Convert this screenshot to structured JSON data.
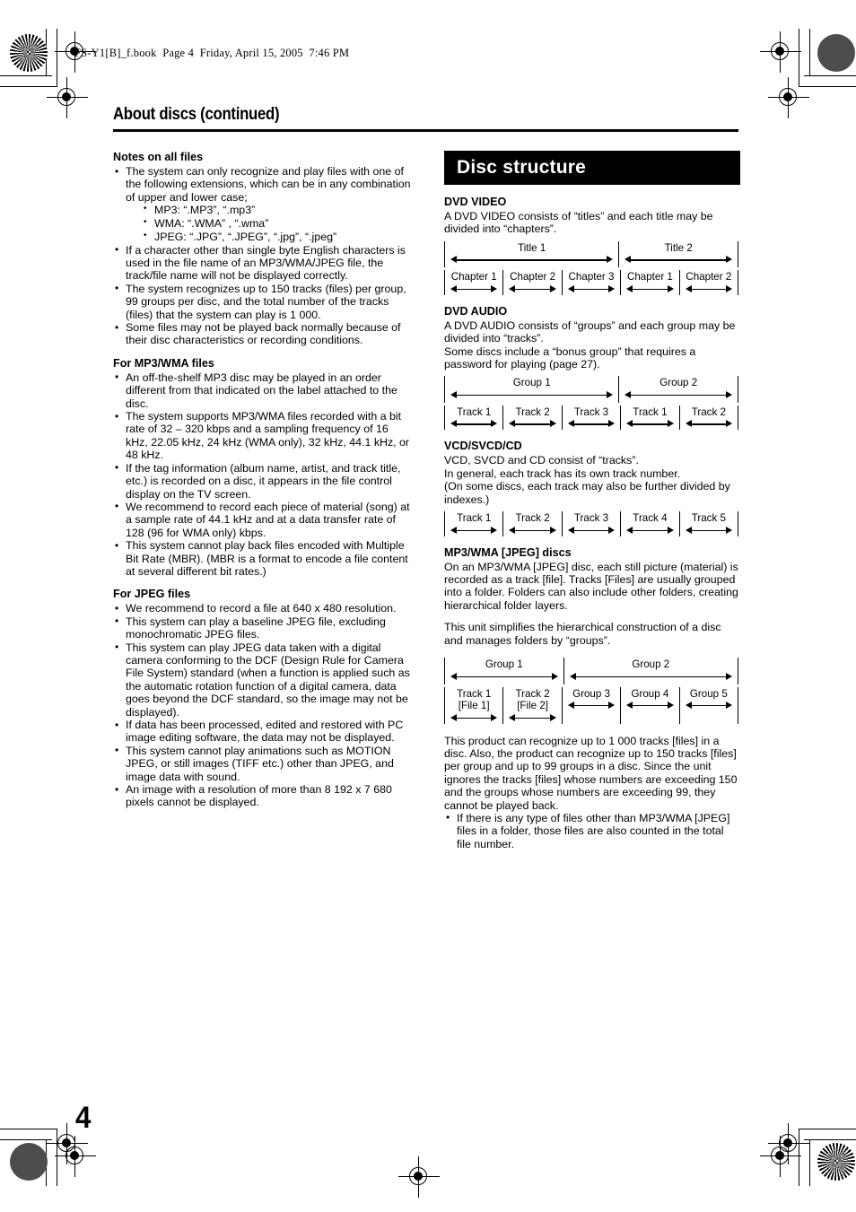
{
  "book_header": "FS-Y1[B]_f.book  Page 4  Friday, April 15, 2005  7:46 PM",
  "page_title": "About discs (continued)",
  "page_number": "4",
  "left_column": {
    "sections": [
      {
        "heading": "Notes on all files",
        "bullets": [
          "The system can only recognize and play files with one of the following extensions, which can be in any combination of upper and lower case;",
          "If a character other than single byte English characters is used in the file name of an MP3/WMA/JPEG file, the track/file name will not be displayed correctly.",
          "The system recognizes up to 150 tracks (files) per group, 99 groups per disc, and the total number of the tracks (files) that the system can play is 1 000.",
          "Some files may not be played back normally because of their disc characteristics or recording conditions."
        ],
        "sub_bullets": [
          "MP3: “.MP3”, “.mp3”",
          "WMA: “.WMA” , “.wma”",
          "JPEG: “.JPG”, “.JPEG”, “.jpg”, “.jpeg”"
        ]
      },
      {
        "heading": "For MP3/WMA files",
        "bullets": [
          "An off-the-shelf MP3 disc may be played in an order different from that indicated on the label attached to the disc.",
          "The system supports MP3/WMA files recorded with a bit rate of 32 – 320 kbps and a sampling frequency of 16 kHz, 22.05 kHz, 24 kHz (WMA only), 32 kHz, 44.1 kHz, or 48 kHz.",
          "If the tag information (album name, artist, and track title, etc.) is recorded on a disc, it appears in the file control display on the TV screen.",
          "We recommend to record each piece of material (song) at a sample rate of 44.1 kHz and at a data transfer rate of 128 (96 for WMA only) kbps.",
          "This system cannot play back files encoded with Multiple Bit Rate (MBR). (MBR is a format to encode a file content at several different bit rates.)"
        ]
      },
      {
        "heading": "For JPEG files",
        "bullets": [
          "We recommend to record a file at 640 x 480 resolution.",
          "This system can play a baseline JPEG file, excluding monochromatic JPEG files.",
          "This system can play JPEG data taken with a digital camera conforming to the DCF (Design Rule for Camera File System) standard (when a function is applied such as the automatic rotation function of a digital camera, data goes beyond the DCF standard, so the image may not be displayed).",
          "If data has been processed, edited and restored with PC image editing software, the data may not be displayed.",
          "This system cannot play animations such as MOTION JPEG, or still images (TIFF etc.) other than JPEG, and image data with sound.",
          "An image with a resolution of more than 8 192 x 7 680 pixels cannot be displayed."
        ]
      }
    ]
  },
  "right_column": {
    "banner_title": "Disc structure",
    "dvd_video": {
      "heading": "DVD VIDEO",
      "paragraph": "A DVD VIDEO consists of “titles” and each title may be divided into “chapters”.",
      "diagram": {
        "top_row": [
          {
            "label": "Title 1",
            "span": 3
          },
          {
            "label": "Title 2",
            "span": 2
          }
        ],
        "bottom_row": [
          {
            "label": "Chapter 1",
            "span": 1
          },
          {
            "label": "Chapter 2",
            "span": 1
          },
          {
            "label": "Chapter 3",
            "span": 1
          },
          {
            "label": "Chapter 1",
            "span": 1
          },
          {
            "label": "Chapter 2",
            "span": 1
          }
        ]
      }
    },
    "dvd_audio": {
      "heading": "DVD AUDIO",
      "paragraph": "A DVD AUDIO consists of “groups” and each group may be divided into “tracks”.\nSome discs include a “bonus group” that requires a password for playing (page 27).",
      "diagram": {
        "top_row": [
          {
            "label": "Group 1",
            "span": 3
          },
          {
            "label": "Group 2",
            "span": 2
          }
        ],
        "bottom_row": [
          {
            "label": "Track 1",
            "span": 1
          },
          {
            "label": "Track 2",
            "span": 1
          },
          {
            "label": "Track 3",
            "span": 1
          },
          {
            "label": "Track 1",
            "span": 1
          },
          {
            "label": "Track 2",
            "span": 1
          }
        ]
      }
    },
    "vcd_svcd_cd": {
      "heading": "VCD/SVCD/CD",
      "paragraph": "VCD, SVCD and CD consist of “tracks”.\nIn general, each track has its own track number.\n(On some discs, each track may also be further divided by indexes.)",
      "diagram": {
        "bottom_row": [
          {
            "label": "Track 1",
            "span": 1
          },
          {
            "label": "Track 2",
            "span": 1
          },
          {
            "label": "Track 3",
            "span": 1
          },
          {
            "label": "Track 4",
            "span": 1
          },
          {
            "label": "Track 5",
            "span": 1
          }
        ]
      }
    },
    "mp3_wma_jpeg": {
      "heading": "MP3/WMA [JPEG] discs",
      "paragraph1": "On an MP3/WMA [JPEG] disc, each still picture (material) is recorded as a track [file]. Tracks [Files] are usually grouped into a folder. Folders can also include other folders, creating hierarchical folder layers.",
      "paragraph2": "This unit simplifies the hierarchical construction of a disc and manages folders by “groups”.",
      "diagram": {
        "top_row": [
          {
            "label": "Group 1",
            "span": 2
          },
          {
            "label": "Group 2",
            "span": 3
          }
        ],
        "bottom_row": [
          {
            "label": "Track 1\n[File 1]",
            "span": 1
          },
          {
            "label": "Track 2\n[File 2]",
            "span": 1
          },
          {
            "label": "Group 3",
            "span": 1
          },
          {
            "label": "Group 4",
            "span": 1
          },
          {
            "label": "Group 5",
            "span": 1
          }
        ]
      },
      "paragraph3": "This product can recognize up to 1 000 tracks [files] in a disc. Also, the product can recognize up to 150 tracks [files] per group and up to 99 groups in a disc. Since the unit ignores the tracks [files] whose numbers are exceeding 150 and the groups whose numbers are exceeding 99, they cannot be played back.",
      "bullets": [
        "If there is any type of files other than MP3/WMA [JPEG] files in a folder, those files are also counted in the total file number."
      ]
    }
  }
}
